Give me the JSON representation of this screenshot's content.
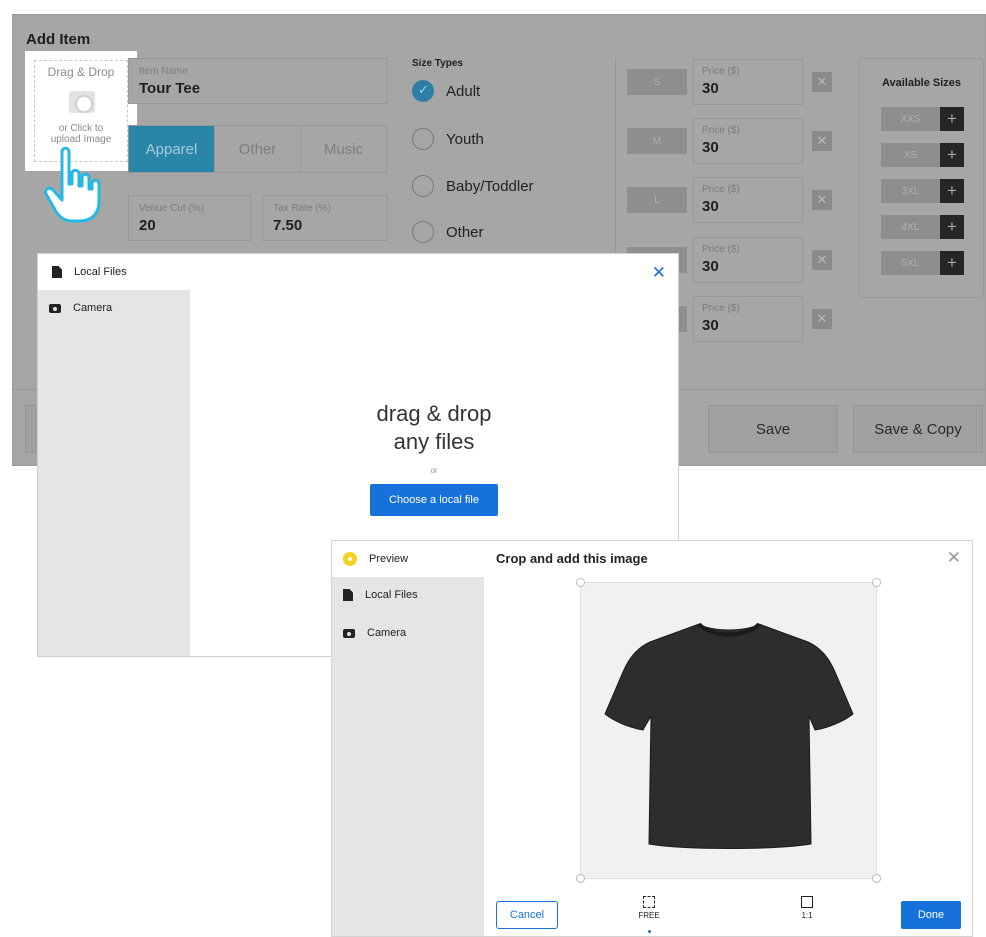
{
  "form": {
    "title": "Add Item",
    "dropzone": {
      "top": "Drag & Drop",
      "bottom_line1": "or Click to",
      "bottom_line2": "upload Image"
    },
    "item_name": {
      "label": "Item Name",
      "value": "Tour Tee"
    },
    "categories": [
      "Apparel",
      "Other",
      "Music"
    ],
    "venue_cut": {
      "label": "Venue Cut (%)",
      "value": "20"
    },
    "tax_rate": {
      "label": "Tax Rate (%)",
      "value": "7.50"
    },
    "size_types": {
      "label": "Size Types",
      "options": [
        "Adult",
        "Youth",
        "Baby/Toddler",
        "Other"
      ],
      "selected": "Adult"
    },
    "sizes": [
      {
        "size": "S",
        "price_label": "Price ($)",
        "price": "30"
      },
      {
        "size": "M",
        "price_label": "Price ($)",
        "price": "30"
      },
      {
        "size": "L",
        "price_label": "Price ($)",
        "price": "30"
      },
      {
        "size": "",
        "price_label": "Price ($)",
        "price": "30"
      },
      {
        "size": "",
        "price_label": "Price ($)",
        "price": "30"
      }
    ],
    "remove_glyph": "✕",
    "available_sizes": {
      "title": "Available Sizes",
      "items": [
        "XXS",
        "XS",
        "3XL",
        "4XL",
        "5XL"
      ],
      "add_glyph": "+"
    },
    "save_label": "Save",
    "save_copy_label": "Save & Copy"
  },
  "upload_modal": {
    "title": "Local Files",
    "close_glyph": "✕",
    "sidebar": [
      "Camera"
    ],
    "drag_line1": "drag & drop",
    "drag_line2": "any files",
    "or": "or",
    "choose_label": "Choose a local file"
  },
  "crop_modal": {
    "title": "Crop and add this image",
    "close_glyph": "✕",
    "sidebar": [
      "Preview",
      "Local Files",
      "Camera"
    ],
    "cancel_label": "Cancel",
    "ratio_free": "FREE",
    "ratio_square": "1:1",
    "done_label": "Done"
  },
  "colors": {
    "accent_blue": "#1671db",
    "apparel_tab": "#2a86a8",
    "preview_badge": "#f4d11d",
    "pointer": "#23b8e6"
  },
  "icons": [
    "camera-icon",
    "pointer-hand-icon",
    "file-icon",
    "close-icon",
    "checkmark-icon",
    "plus-icon",
    "crop-free-icon",
    "crop-square-icon"
  ]
}
